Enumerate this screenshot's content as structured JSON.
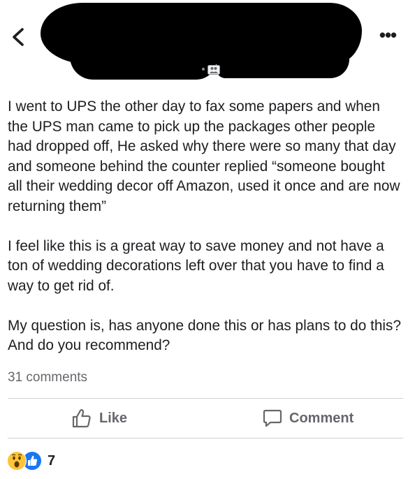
{
  "header": {
    "back_icon": "chevron-left-icon",
    "more_icon": "more-dots-icon",
    "more_label": "•••",
    "privacy_icon": "friends-icon"
  },
  "post": {
    "paragraphs": [
      "I went to UPS the other day to fax some papers and when the UPS man came to pick up the packages other people had dropped off, He asked why there were so many that day and someone behind the counter replied “someone bought all their wedding decor off Amazon, used it once and are now returning them”",
      "I feel like this is a great way to save money and not have a ton of wedding decorations left over that you have to find a way to get rid of.",
      "My question is, has anyone done this or has plans to do this? And do you recommend?"
    ],
    "comments_count": "31 comments"
  },
  "actions": {
    "like_label": "Like",
    "comment_label": "Comment"
  },
  "reactions": {
    "types": [
      "wow-icon",
      "like-icon"
    ],
    "count": "7"
  },
  "colors": {
    "text": "#1c1e21",
    "muted": "#65676b",
    "divider": "#ced0d4",
    "like_blue": "#1877f2",
    "wow_yellow": "#fdc43b"
  }
}
